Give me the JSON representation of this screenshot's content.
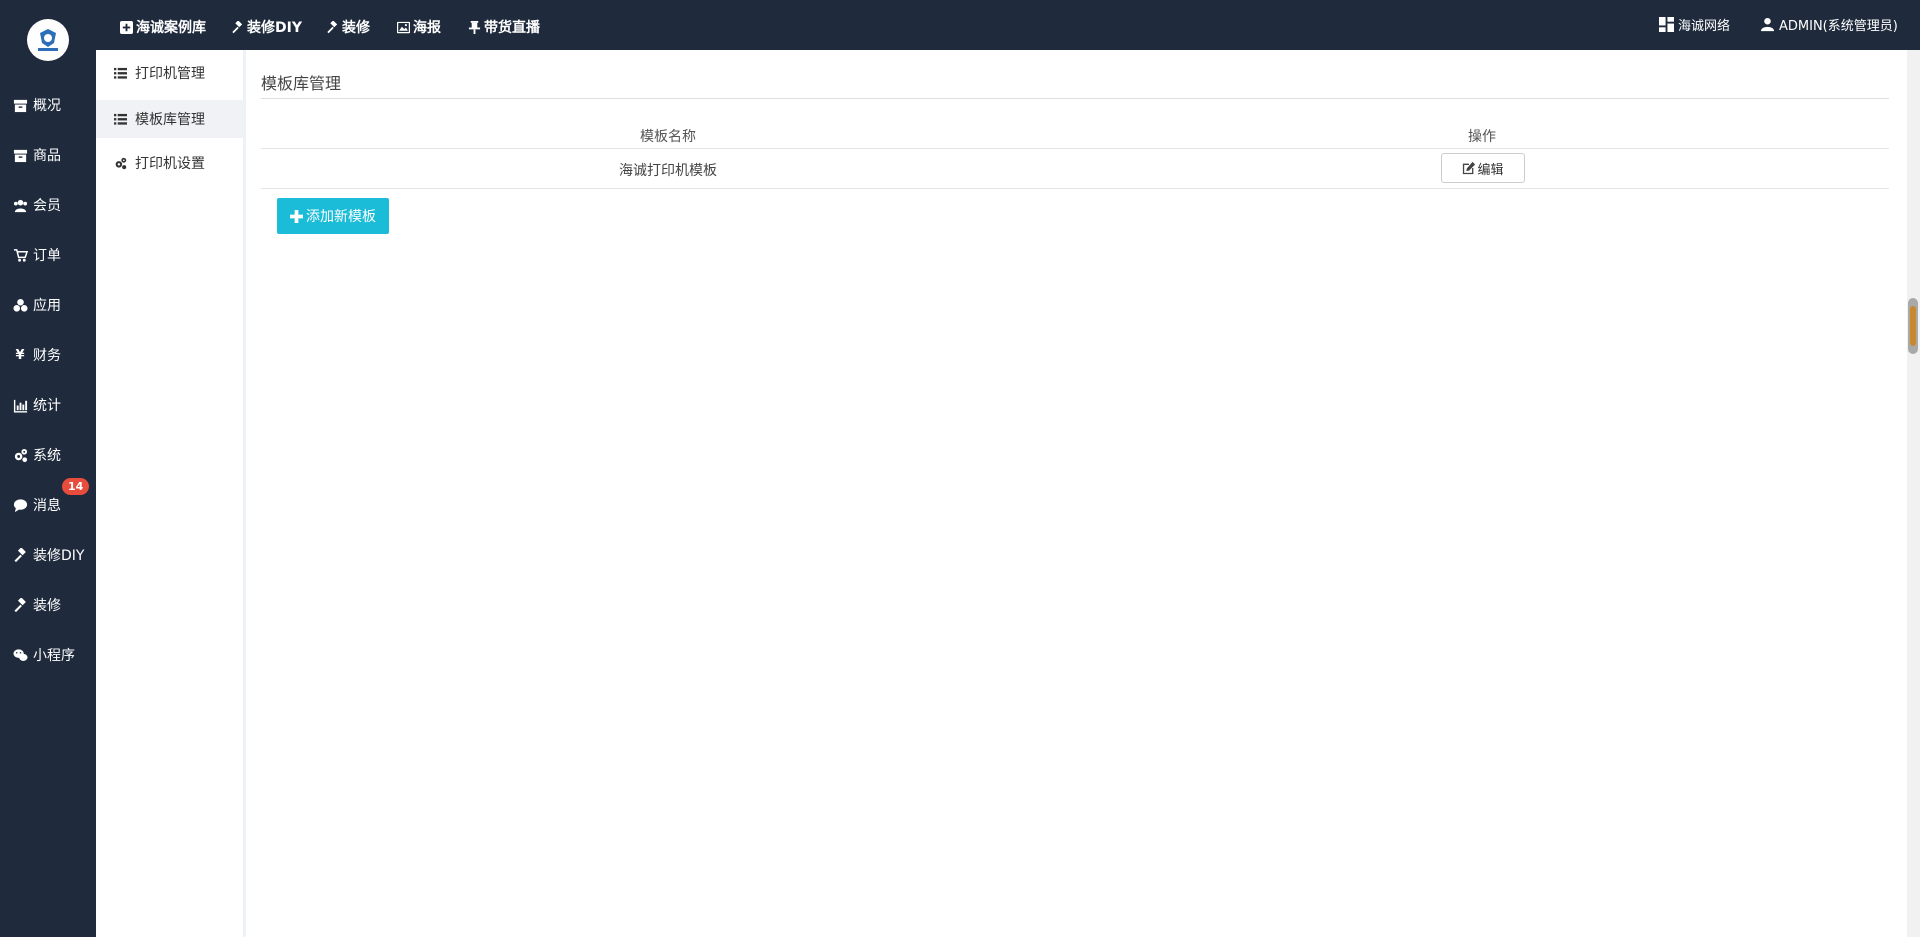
{
  "sidebar": {
    "items": [
      {
        "label": "概况",
        "icon": "archive-icon"
      },
      {
        "label": "商品",
        "icon": "archive-icon"
      },
      {
        "label": "会员",
        "icon": "users-icon"
      },
      {
        "label": "订单",
        "icon": "cart-icon"
      },
      {
        "label": "应用",
        "icon": "cubes-icon"
      },
      {
        "label": "财务",
        "icon": "yen-icon"
      },
      {
        "label": "统计",
        "icon": "bar-chart-icon"
      },
      {
        "label": "系统",
        "icon": "cogs-icon"
      },
      {
        "label": "消息",
        "icon": "comment-icon",
        "badge": "14"
      },
      {
        "label": "装修DIY",
        "icon": "gavel-icon"
      },
      {
        "label": "装修",
        "icon": "gavel-icon"
      },
      {
        "label": "小程序",
        "icon": "wechat-icon"
      }
    ]
  },
  "topnav": {
    "items": [
      {
        "label": "海诚案例库",
        "icon": "plus-square-icon"
      },
      {
        "label": "装修DIY",
        "icon": "gavel-icon"
      },
      {
        "label": "装修",
        "icon": "gavel-icon"
      },
      {
        "label": "海报",
        "icon": "image-icon"
      },
      {
        "label": "带货直播",
        "icon": "pin-icon"
      }
    ],
    "site_label": "海诚网络",
    "user_label": "ADMIN(系统管理员)"
  },
  "subnav": {
    "items": [
      {
        "label": "打印机管理",
        "icon": "list-icon"
      },
      {
        "label": "模板库管理",
        "icon": "list-icon",
        "active": true
      },
      {
        "label": "打印机设置",
        "icon": "cogs-icon"
      }
    ]
  },
  "main": {
    "title": "模板库管理",
    "table": {
      "headers": [
        "模板名称",
        "操作"
      ],
      "rows": [
        {
          "name": "海诚打印机模板",
          "action": "编辑"
        }
      ]
    },
    "add_button": "添加新模板"
  },
  "colors": {
    "sidebar_bg": "#1f2b3c",
    "accent": "#1bbcd8",
    "badge": "#e74c3c"
  }
}
